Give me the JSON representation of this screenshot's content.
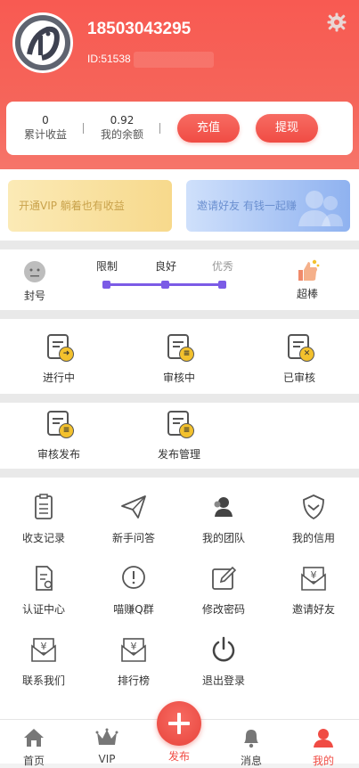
{
  "header": {
    "phone": "18503043295",
    "id_label": "ID:51538",
    "settings_icon": "gear-icon"
  },
  "stats": {
    "income_value": "0",
    "income_label": "累计收益",
    "balance_value": "0.92",
    "balance_label": "我的余额",
    "recharge_label": "充值",
    "withdraw_label": "提现"
  },
  "promo": {
    "vip": "开通VIP 躺着也有收益",
    "invite": "邀请好友 有钱一起赚"
  },
  "credit": {
    "left_label": "封号",
    "right_label": "超棒",
    "levels": [
      "限制",
      "良好",
      "优秀"
    ]
  },
  "status_tiles": [
    {
      "label": "进行中",
      "icon": "arrow-right-icon"
    },
    {
      "label": "审核中",
      "icon": "review-icon"
    },
    {
      "label": "已审核",
      "icon": "cross-icon"
    }
  ],
  "publish_tiles": [
    {
      "label": "审核发布",
      "icon": "review-icon"
    },
    {
      "label": "发布管理",
      "icon": "review-icon"
    }
  ],
  "menu": [
    {
      "label": "收支记录",
      "icon": "clipboard-icon"
    },
    {
      "label": "新手问答",
      "icon": "paper-plane-icon"
    },
    {
      "label": "我的团队",
      "icon": "team-icon"
    },
    {
      "label": "我的信用",
      "icon": "shield-icon"
    },
    {
      "label": "认证中心",
      "icon": "certificate-icon"
    },
    {
      "label": "喵赚Q群",
      "icon": "exclamation-bubble-icon"
    },
    {
      "label": "修改密码",
      "icon": "edit-icon"
    },
    {
      "label": "邀请好友",
      "icon": "yen-envelope-icon"
    },
    {
      "label": "联系我们",
      "icon": "yen-envelope-icon"
    },
    {
      "label": "排行榜",
      "icon": "yen-envelope-icon"
    },
    {
      "label": "退出登录",
      "icon": "power-icon"
    }
  ],
  "tabbar": {
    "home": "首页",
    "vip": "VIP",
    "publish": "发布",
    "messages": "消息",
    "mine": "我的"
  },
  "colors": {
    "brand": "#f5584f",
    "accent_purple": "#7b5be6"
  }
}
